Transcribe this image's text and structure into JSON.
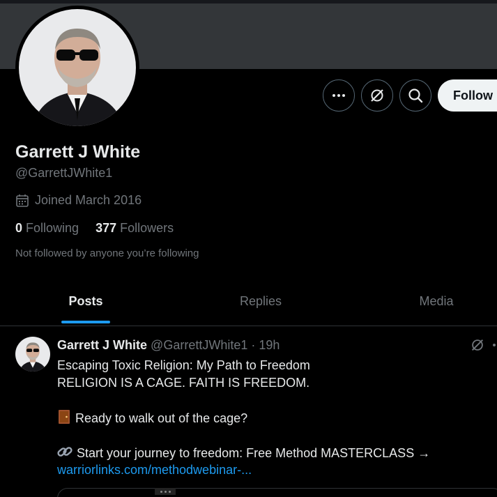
{
  "profile": {
    "name": "Garrett J White",
    "handle": "@GarrettJWhite1",
    "joined": "Joined March 2016",
    "following_count": "0",
    "following_label": "Following",
    "followers_count": "377",
    "followers_label": "Followers",
    "not_followed": "Not followed by anyone you’re following"
  },
  "actions": {
    "follow_label": "Follow",
    "icons": [
      "more-icon",
      "grok-icon",
      "search-icon"
    ]
  },
  "tabs": [
    {
      "label": "Posts",
      "active": true
    },
    {
      "label": "Replies",
      "active": false
    },
    {
      "label": "Media",
      "active": false
    }
  ],
  "post": {
    "author": "Garrett J White",
    "handle_time": "@GarrettJWhite1 · 19h",
    "lines": [
      "Escaping Toxic Religion: My Path to Freedom",
      "RELIGION IS A CAGE. FAITH IS FREEDOM.",
      "Ready to walk out of the cage?",
      "Start your journey to freedom: Free Method MASTERCLASS →",
      "warriorlinks.com/methodwebinar-..."
    ],
    "icons": [
      "door-emoji-icon",
      "link-emoji-icon"
    ]
  },
  "colors": {
    "accent": "#1d9bf0",
    "background": "#000000",
    "banner": "#333639",
    "muted_text": "#71767b"
  }
}
